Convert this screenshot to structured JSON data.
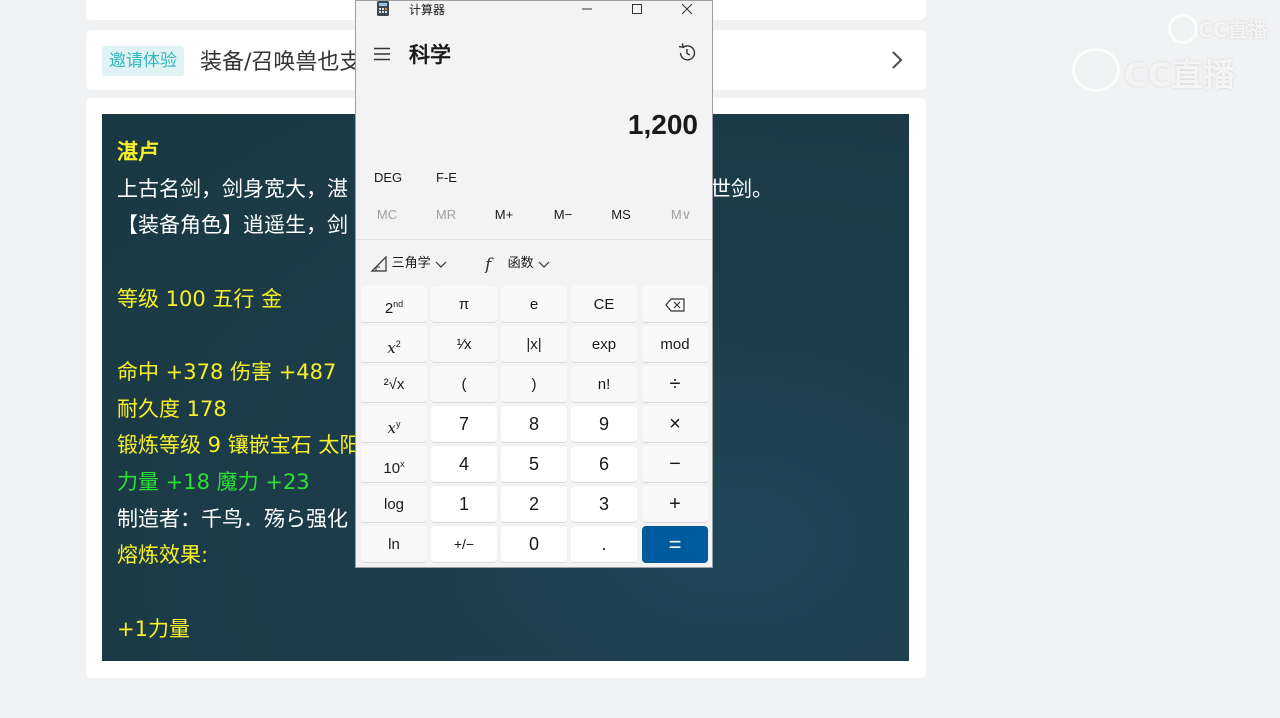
{
  "page": {
    "invite_badge": "邀请体验",
    "invite_text": "装备/召唤兽也支"
  },
  "tooltip": {
    "name": "湛卢",
    "lines": [
      {
        "text": "上古名剑，剑身宽大，湛",
        "color": "white"
      },
      {
        "text": "世剑。",
        "color": "white"
      },
      {
        "text": "【装备角色】逍遥生，剑",
        "color": "white"
      },
      {
        "text": "等级 100 五行 金",
        "color": "yellow"
      },
      {
        "text": "命中 +378 伤害 +487",
        "color": "yellow"
      },
      {
        "text": "耐久度 178",
        "color": "yellow"
      },
      {
        "text": "锻炼等级 9 镶嵌宝石 太阳",
        "color": "yellow"
      },
      {
        "text": "力量 +18 魔力 +23",
        "color": "green"
      },
      {
        "text": "制造者：千鸟．殇ら强化",
        "color": "white"
      },
      {
        "text": "熔炼效果:",
        "color": "yellow"
      },
      {
        "text": "+1力量",
        "color": "yellow"
      }
    ]
  },
  "watermark": {
    "small": "CC直播",
    "large": "CC直播"
  },
  "calculator": {
    "app_title": "计算器",
    "mode_title": "科学",
    "display": "1,200",
    "angle_mode": "DEG",
    "fe_label": "F-E",
    "memory": [
      "MC",
      "MR",
      "M+",
      "M−",
      "MS",
      "M∨"
    ],
    "trig_label": "三角学",
    "func_label": "函数",
    "keys": {
      "second": "2",
      "second_sup": "nd",
      "pi": "π",
      "e": "e",
      "ce": "CE",
      "square_base": "x",
      "square_sup": "2",
      "reciprocal": "¹⁄x",
      "abs": "|x|",
      "exp": "exp",
      "mod": "mod",
      "root": "²√x",
      "lparen": "(",
      "rparen": ")",
      "factorial": "n!",
      "divide": "÷",
      "power_base": "x",
      "power_sup": "y",
      "seven": "7",
      "eight": "8",
      "nine": "9",
      "multiply": "×",
      "tenx_base": "10",
      "tenx_sup": "x",
      "four": "4",
      "five": "5",
      "six": "6",
      "minus": "−",
      "log": "log",
      "one": "1",
      "two": "2",
      "three": "3",
      "plus": "+",
      "ln": "ln",
      "negate": "+/−",
      "zero": "0",
      "decimal": ".",
      "equals": "="
    }
  }
}
